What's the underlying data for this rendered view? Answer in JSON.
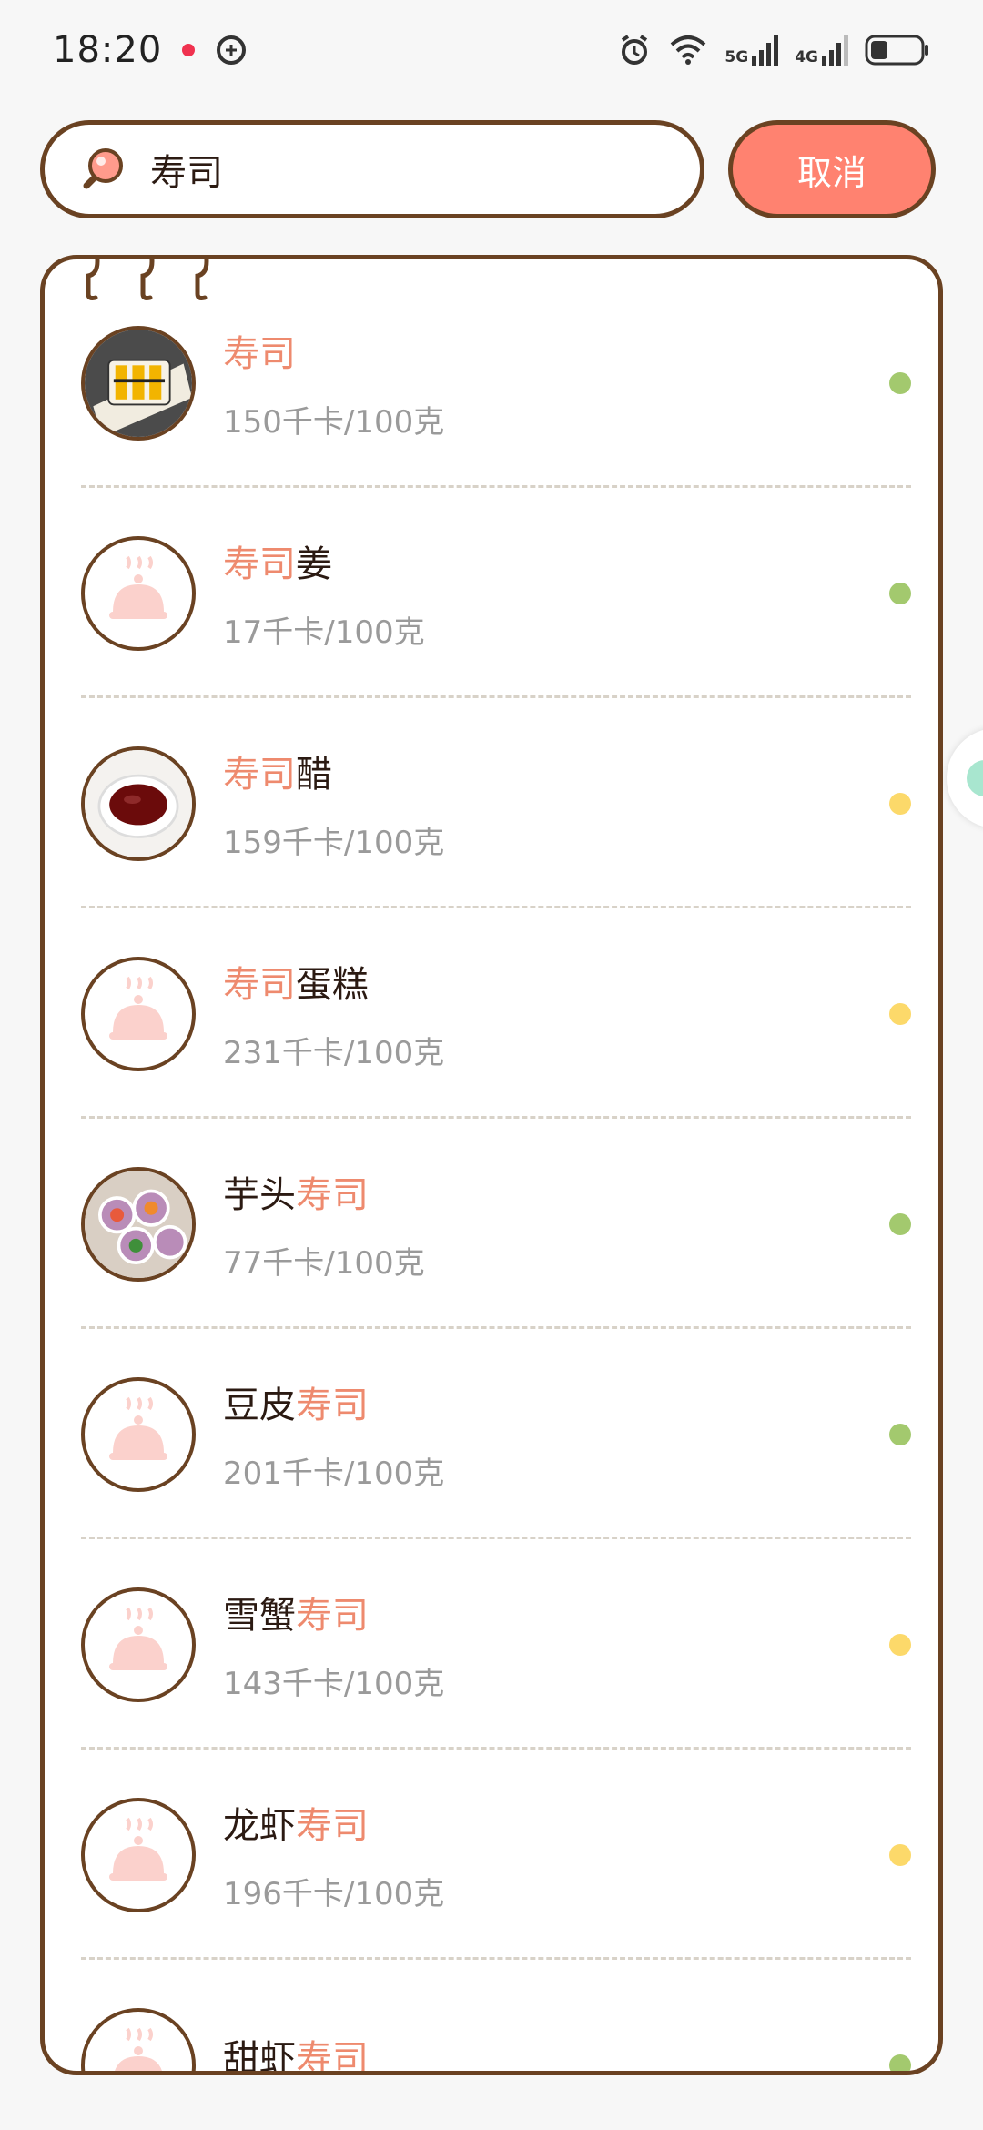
{
  "status_bar": {
    "time": "18:20",
    "network_5g": "5G",
    "network_4g": "4G"
  },
  "search": {
    "query": "寿司",
    "cancel_label": "取消"
  },
  "colors": {
    "accent": "#ff8270",
    "border": "#6a4222",
    "highlight": "#ee8a6e",
    "dot_green": "#a3c96e",
    "dot_yellow": "#fcd96a"
  },
  "items": [
    {
      "prefix": "",
      "highlight": "寿司",
      "suffix": "",
      "calories": "150千卡/100克",
      "image": "sushi-roll-photo",
      "status": "green"
    },
    {
      "prefix": "",
      "highlight": "寿司",
      "suffix": "姜",
      "calories": "17千卡/100克",
      "image": "placeholder-icon",
      "status": "green"
    },
    {
      "prefix": "",
      "highlight": "寿司",
      "suffix": "醋",
      "calories": "159千卡/100克",
      "image": "sauce-dish-photo",
      "status": "yellow"
    },
    {
      "prefix": "",
      "highlight": "寿司",
      "suffix": "蛋糕",
      "calories": "231千卡/100克",
      "image": "placeholder-icon",
      "status": "yellow"
    },
    {
      "prefix": "芋头",
      "highlight": "寿司",
      "suffix": "",
      "calories": "77千卡/100克",
      "image": "taro-sushi-photo",
      "status": "green"
    },
    {
      "prefix": "豆皮",
      "highlight": "寿司",
      "suffix": "",
      "calories": "201千卡/100克",
      "image": "placeholder-icon",
      "status": "green"
    },
    {
      "prefix": "雪蟹",
      "highlight": "寿司",
      "suffix": "",
      "calories": "143千卡/100克",
      "image": "placeholder-icon",
      "status": "yellow"
    },
    {
      "prefix": "龙虾",
      "highlight": "寿司",
      "suffix": "",
      "calories": "196千卡/100克",
      "image": "placeholder-icon",
      "status": "yellow"
    },
    {
      "prefix": "甜虾",
      "highlight": "寿司",
      "suffix": "",
      "calories": "",
      "image": "placeholder-icon",
      "status": "green"
    }
  ]
}
